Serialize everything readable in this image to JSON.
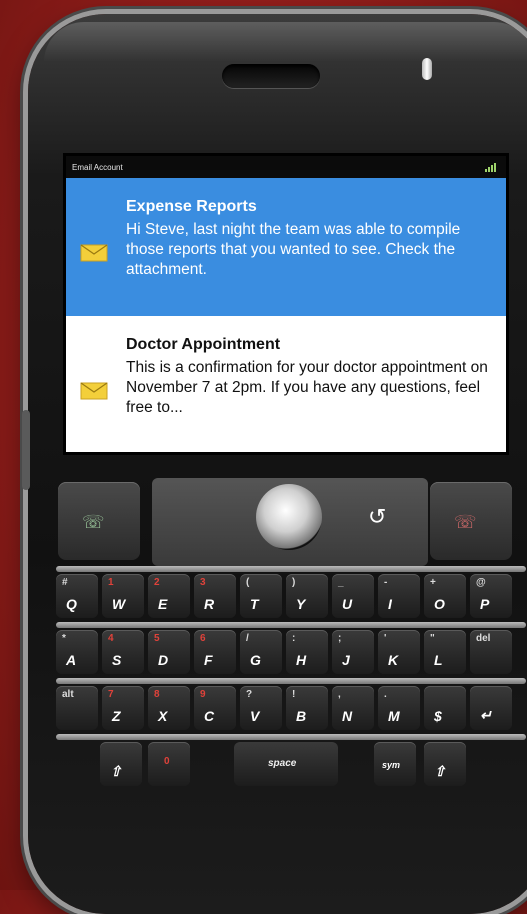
{
  "status_bar": {
    "title": "Email Account",
    "signal_bars": 4
  },
  "messages": [
    {
      "subject": "Expense Reports",
      "preview": "Hi Steve, last night the team was able to compile those reports that you wanted to see. Check the attachment.",
      "selected": true
    },
    {
      "subject": "Doctor Appointment",
      "preview": "This is a confirmation for your doctor appointment on November 7 at 2pm. If you have any questions, feel free to...",
      "selected": false
    }
  ],
  "keyboard": {
    "row1": [
      {
        "k": "Q",
        "a": "#"
      },
      {
        "k": "W",
        "a": "1"
      },
      {
        "k": "E",
        "a": "2"
      },
      {
        "k": "R",
        "a": "3"
      },
      {
        "k": "T",
        "a": "("
      },
      {
        "k": "Y",
        "a": ")"
      },
      {
        "k": "U",
        "a": "_"
      },
      {
        "k": "I",
        "a": "-"
      },
      {
        "k": "O",
        "a": "+"
      },
      {
        "k": "P",
        "a": "@"
      }
    ],
    "row2": [
      {
        "k": "A",
        "a": "*"
      },
      {
        "k": "S",
        "a": "4"
      },
      {
        "k": "D",
        "a": "5"
      },
      {
        "k": "F",
        "a": "6"
      },
      {
        "k": "G",
        "a": "/"
      },
      {
        "k": "H",
        "a": ":"
      },
      {
        "k": "J",
        "a": ";"
      },
      {
        "k": "K",
        "a": "'"
      },
      {
        "k": "L",
        "a": "\""
      },
      {
        "k": "",
        "a": "del"
      }
    ],
    "row3": [
      {
        "k": "",
        "a": "alt"
      },
      {
        "k": "Z",
        "a": "7"
      },
      {
        "k": "X",
        "a": "8"
      },
      {
        "k": "C",
        "a": "9"
      },
      {
        "k": "V",
        "a": "?"
      },
      {
        "k": "B",
        "a": "!"
      },
      {
        "k": "N",
        "a": ","
      },
      {
        "k": "M",
        "a": "."
      },
      {
        "k": "$",
        "a": ""
      },
      {
        "k": "↵",
        "a": ""
      }
    ],
    "row4": {
      "left": "⇧",
      "zero": "0",
      "space": "space",
      "sym": "sym",
      "right": "⇧"
    }
  },
  "colors": {
    "selected_bg": "#3a8de0",
    "envelope": "#f3cf3a",
    "accent_red": "#e0423a"
  }
}
